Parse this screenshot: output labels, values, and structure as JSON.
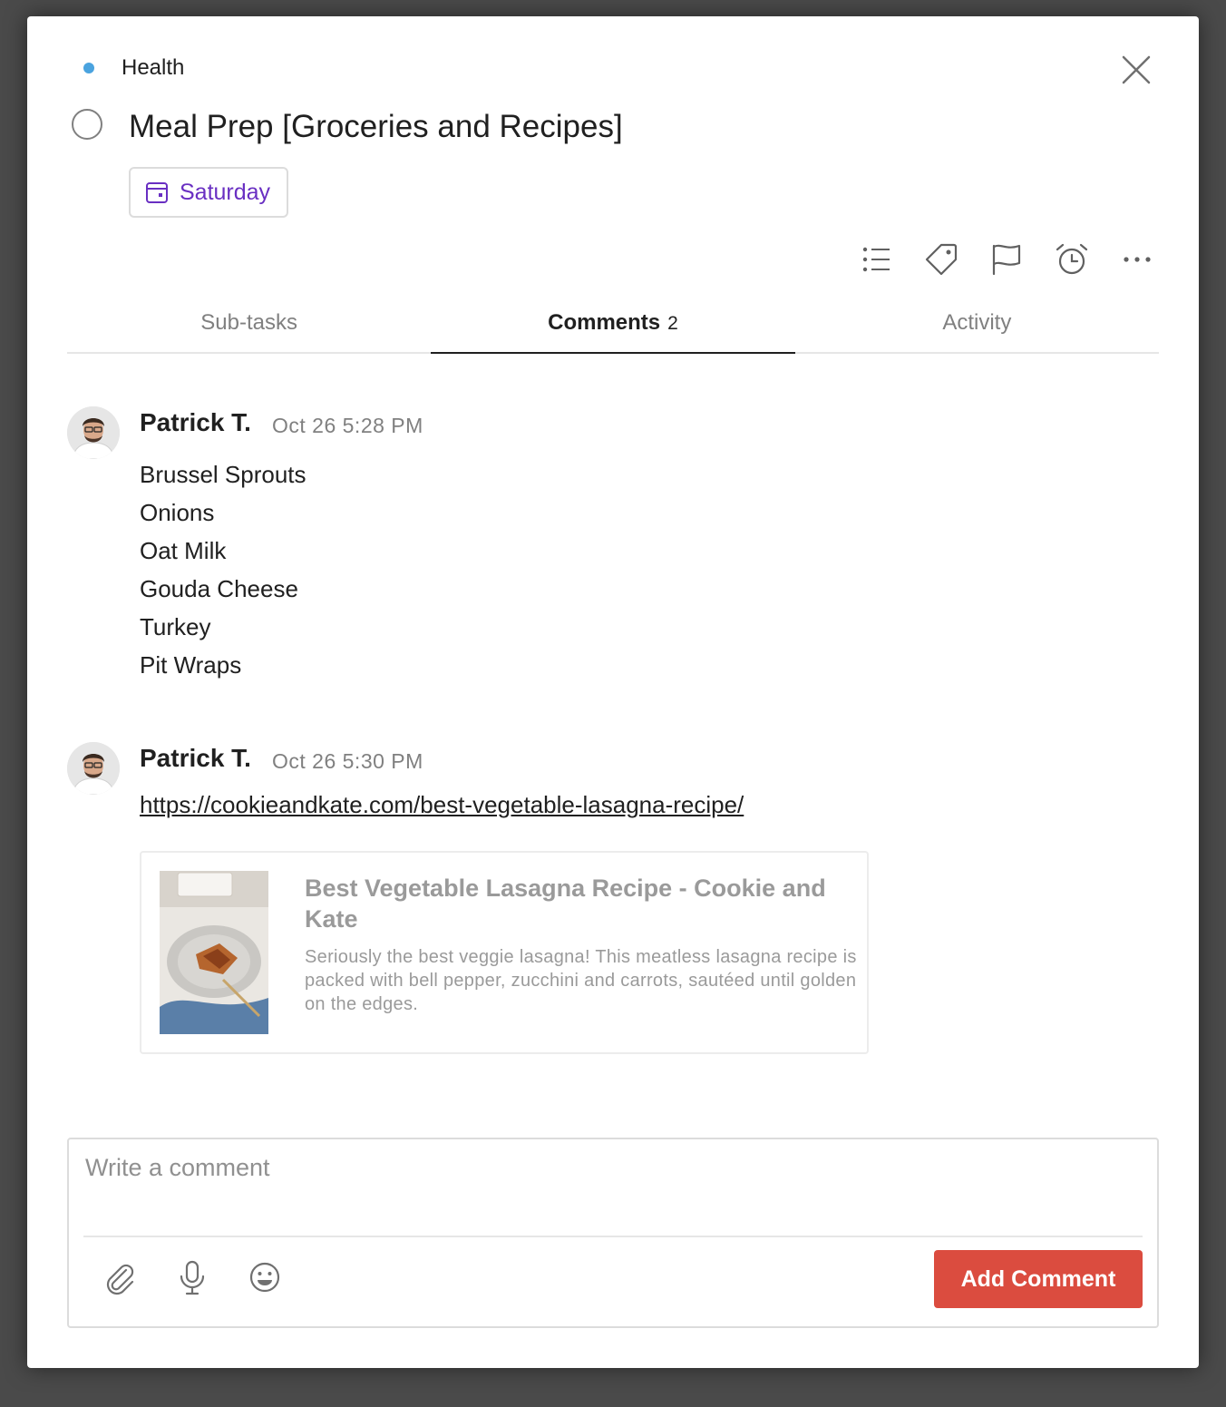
{
  "project": {
    "name": "Health",
    "color": "#4aa3df"
  },
  "task": {
    "title": "Meal Prep [Groceries and Recipes]",
    "due_label": "Saturday"
  },
  "toolbar": {
    "icons": [
      "subtasks-list-icon",
      "label-tag-icon",
      "priority-flag-icon",
      "reminder-alarm-icon",
      "more-icon"
    ]
  },
  "tabs": [
    {
      "label": "Sub-tasks",
      "count": ""
    },
    {
      "label": "Comments",
      "count": "2"
    },
    {
      "label": "Activity",
      "count": ""
    }
  ],
  "comments": [
    {
      "author": "Patrick T.",
      "time": "Oct 26 5:28 PM",
      "lines": [
        "Brussel Sprouts",
        "Onions",
        "Oat Milk",
        "Gouda Cheese",
        "Turkey",
        "Pit Wraps"
      ]
    },
    {
      "author": "Patrick T.",
      "time": "Oct 26 5:30 PM",
      "link": "https://cookieandkate.com/best-vegetable-lasagna-recipe/",
      "preview": {
        "title": "Best Vegetable Lasagna Recipe - Cookie and Kate",
        "description": "Seriously the best veggie lasagna! This meatless lasagna recipe is packed with bell pepper, zucchini and carrots, sautéed until golden on the edges."
      }
    }
  ],
  "composer": {
    "placeholder": "Write a comment",
    "submit_label": "Add Comment",
    "icons": [
      "attachment-paperclip-icon",
      "microphone-icon",
      "emoji-smile-icon"
    ]
  },
  "colors": {
    "accent": "#db4c3f",
    "date_purple": "#692fc2"
  }
}
